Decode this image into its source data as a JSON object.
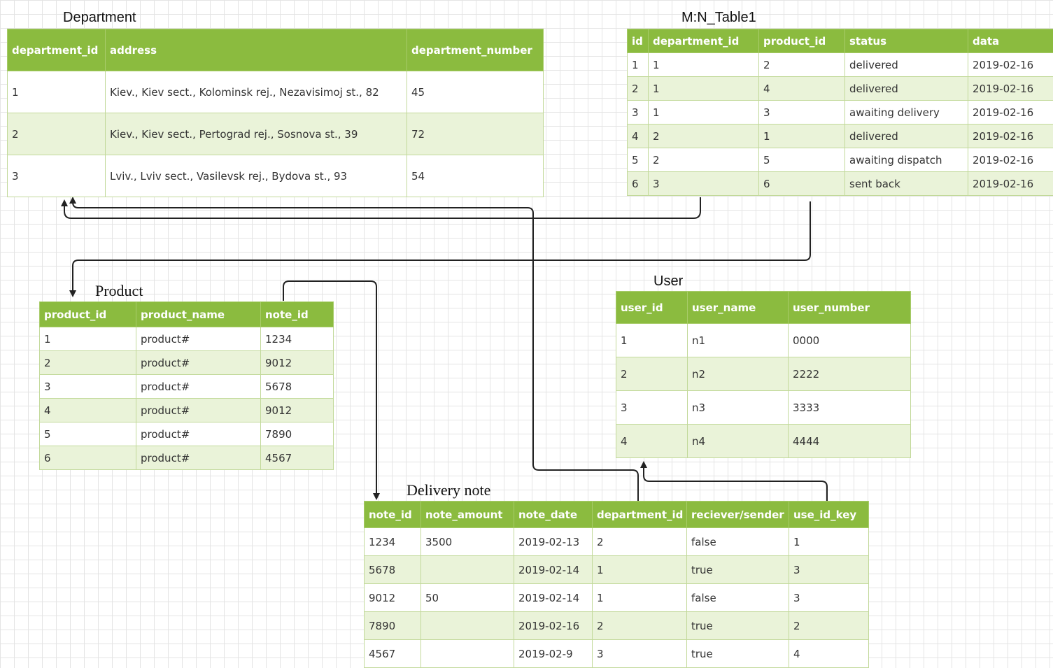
{
  "department": {
    "title": "Department",
    "columns": [
      "department_id",
      "address",
      "department_number"
    ],
    "rows": [
      [
        "1",
        "Kiev., Kiev sect., Kolominsk rej., Nezavisimoj st., 82",
        "45"
      ],
      [
        "2",
        "Kiev., Kiev sect., Pertograd rej., Sosnova st., 39",
        "72"
      ],
      [
        "3",
        "Lviv., Lviv sect., Vasilevsk rej., Bydova st., 93",
        "54"
      ]
    ]
  },
  "mn_table": {
    "title": "M:N_Table1",
    "columns": [
      "id",
      "department_id",
      "product_id",
      "status",
      "data"
    ],
    "rows": [
      [
        "1",
        "1",
        "2",
        "delivered",
        "2019-02-16"
      ],
      [
        "2",
        "1",
        "4",
        "delivered",
        "2019-02-16"
      ],
      [
        "3",
        "1",
        "3",
        "awaiting delivery",
        "2019-02-16"
      ],
      [
        "4",
        "2",
        "1",
        "delivered",
        "2019-02-16"
      ],
      [
        "5",
        "2",
        "5",
        "awaiting dispatch",
        "2019-02-16"
      ],
      [
        "6",
        "3",
        "6",
        "sent back",
        "2019-02-16"
      ]
    ]
  },
  "product": {
    "title": "Product",
    "columns": [
      "product_id",
      "product_name",
      "note_id"
    ],
    "rows": [
      [
        "1",
        "product#",
        "1234"
      ],
      [
        "2",
        "product#",
        "9012"
      ],
      [
        "3",
        "product#",
        "5678"
      ],
      [
        "4",
        "product#",
        "9012"
      ],
      [
        "5",
        "product#",
        "7890"
      ],
      [
        "6",
        "product#",
        "4567"
      ]
    ]
  },
  "user": {
    "title": "User",
    "columns": [
      "user_id",
      "user_name",
      "user_number"
    ],
    "rows": [
      [
        "1",
        "n1",
        "0000"
      ],
      [
        "2",
        "n2",
        "2222"
      ],
      [
        "3",
        "n3",
        "3333"
      ],
      [
        "4",
        "n4",
        "4444"
      ]
    ]
  },
  "delivery_note": {
    "title": "Delivery note",
    "columns": [
      "note_id",
      "note_amount",
      "note_date",
      "department_id",
      "reciever/sender",
      "use_id_key"
    ],
    "rows": [
      [
        "1234",
        "3500",
        "2019-02-13",
        "2",
        "false",
        "1"
      ],
      [
        "5678",
        "",
        "2019-02-14",
        "1",
        "true",
        "3"
      ],
      [
        "9012",
        "50",
        "2019-02-14",
        "1",
        "false",
        "3"
      ],
      [
        "7890",
        "",
        "2019-02-16",
        "2",
        "true",
        "2"
      ],
      [
        "4567",
        "",
        "2019-02-9",
        "3",
        "true",
        "4"
      ]
    ]
  },
  "colors": {
    "header_green": "#8bbb3f",
    "row_stripe": "#eaf3d9",
    "grid_line": "#e4e4e4",
    "connector": "#222222"
  }
}
